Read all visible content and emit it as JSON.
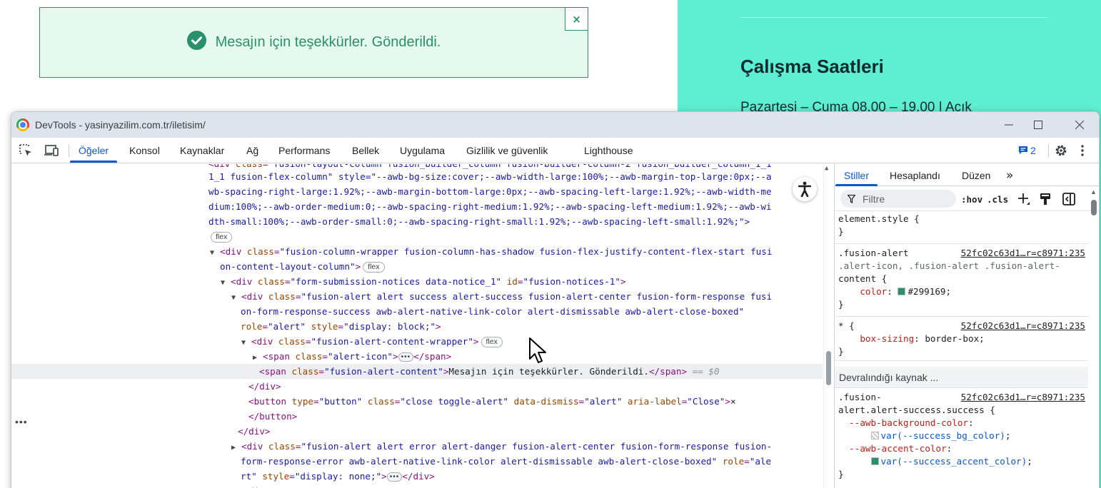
{
  "page": {
    "alert": {
      "message": "Mesajın için teşekkürler. Gönderildi.",
      "close_label": "×",
      "color": "#299169"
    },
    "hours": {
      "title": "Çalışma Saatleri",
      "text": "Pazartesi – Cuma 08.00 – 19.00 | Açık"
    }
  },
  "devtools": {
    "window_title": "DevTools - yasinyazilim.com.tr/iletisim/",
    "tabs": [
      "Öğeler",
      "Konsol",
      "Kaynaklar",
      "Ağ",
      "Performans",
      "Bellek",
      "Uygulama",
      "Gizlilik ve güvenlik",
      "Lighthouse"
    ],
    "active_tab": "Öğeler",
    "issues_count": "2",
    "elements": {
      "flex_label": "flex",
      "selected_suffix": " == $0",
      "l0_attrs": "1_1 fusion-flex-column\" style=\"--awb-bg-size:cover;--awb-width-large:100%;--awb-margin-top-large:0px;--a",
      "l0_cont1": "wb-spacing-right-large:1.92%;--awb-margin-bottom-large:0px;--awb-spacing-left-large:1.92%;--awb-width-me",
      "l0_cont2": "dium:100%;--awb-order-medium:0;--awb-spacing-right-medium:1.92%;--awb-spacing-left-medium:1.92%;--awb-wi",
      "l0_cont3": "dth-small:100%;--awb-order-small:0;--awb-spacing-right-small:1.92%;--awb-spacing-left-small:1.92%;\">",
      "l1_class": "\"fusion-column-wrapper fusion-column-has-shadow fusion-flex-justify-content-flex-start fusi",
      "l1_cont": "on-content-layout-column\"",
      "l2_class": "\"form-submission-notices data-notice_1\"",
      "l2_id": "\"fusion-notices-1\"",
      "l3_class": "\"fusion-alert alert success alert-success fusion-alert-center fusion-form-response fusi",
      "l3_cont": "on-form-response-success awb-alert-native-link-color alert-dismissable awb-alert-close-boxed\"",
      "l3_role": "\"alert\"",
      "l3_style": "\"display: block;\"",
      "l4_class": "\"fusion-alert-content-wrapper\"",
      "l5_class": "\"alert-icon\"",
      "l6_class": "\"fusion-alert-content\"",
      "l6_text": "Mesajın için teşekkürler. Gönderildi.",
      "l8_type": "\"button\"",
      "l8_class": "\"close toggle-alert\"",
      "l8_dismiss": "\"alert\"",
      "l8_aria": "\"Close\"",
      "l8_text": "×",
      "l11_class": "\"fusion-alert alert error alert-danger fusion-alert-center fusion-form-response fusion-",
      "l11_cont": "form-response-error awb-alert-native-link-color alert-dismissable awb-alert-close-boxed\"",
      "l11_role": "\"ale",
      "l11_cont2": "rt\"",
      "l11_style": "\"display: none;\""
    },
    "styles": {
      "tabs": [
        "Stiller",
        "Hesaplandı",
        "Düzen"
      ],
      "filter_placeholder": "Filtre",
      "hov_label": ":hov",
      "cls_label": ".cls",
      "element_style": "element.style {",
      "close_brace": "}",
      "rule1_selector_1": ".fusion-alert",
      "rule1_selector_2": ".alert-icon, .fusion-alert .fusion-alert-",
      "rule1_selector_3": "content {",
      "rule1_source": "52fc02c63d1…r=c8971:235",
      "rule1_prop": "color",
      "rule1_value": "#299169",
      "rule2_selector": "* {",
      "rule2_source": "52fc02c63d1…r=c8971:235",
      "rule2_prop": "box-sizing",
      "rule2_value": "border-box",
      "inherited_label": "Devralındığı kaynak ...",
      "rule3_selector_1": ".fusion-",
      "rule3_selector_2": "alert.alert-success.success {",
      "rule3_source": "52fc02c63d1…r=c8971:235",
      "rule3_prop1": "--awb-background-color",
      "rule3_value1": "var(--success_bg_color)",
      "rule3_prop2": "--awb-accent-color",
      "rule3_value2": "var(--success_accent_color)",
      "accent_swatch": "#299169"
    }
  }
}
